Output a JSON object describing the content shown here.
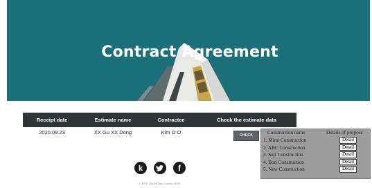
{
  "hero": {
    "title": "Contract Agreement"
  },
  "table": {
    "headers": [
      "Receipt date",
      "Estimate name",
      "Contractee",
      "Check the estimate data"
    ],
    "rows": [
      {
        "receipt_date": "2020.09.23",
        "estimate_name": "XX Gu XX Dong",
        "contractee": "Kim O O"
      }
    ]
  },
  "check_button": {
    "label": "CHECK"
  },
  "popup": {
    "headers": [
      "Construction name",
      "Details of propose"
    ],
    "items": [
      {
        "name": "1. Mimi Construction",
        "button": "Detail"
      },
      {
        "name": "2. ABC Construction",
        "button": "Detail"
      },
      {
        "name": "3. Suji Construction",
        "button": "Detail"
      },
      {
        "name": "4. Bori Construction",
        "button": "Detail"
      },
      {
        "name": "5. New Construction",
        "button": "Detail"
      }
    ]
  },
  "social": [
    {
      "icon": "kakaostory-icon",
      "glyph": "k"
    },
    {
      "icon": "twitter-icon"
    },
    {
      "icon": "facebook-icon",
      "glyph": "f"
    }
  ],
  "footer": {
    "copyright": "© BYC_Build Your Carrier 2020"
  },
  "colors": {
    "hero_bg": "#1a6f78",
    "table_header_bg": "#2f3436",
    "popup_bg": "#9c9c9c",
    "check_button_bg": "#5b6468"
  }
}
